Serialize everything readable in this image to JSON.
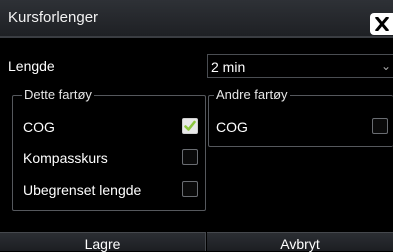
{
  "dialog": {
    "title": "Kursforlenger",
    "close_icon": "close-icon"
  },
  "length": {
    "label": "Lengde",
    "value": "2 min",
    "arrow_icon": "chevron-down-icon"
  },
  "own_vessel": {
    "legend": "Dette fartøy",
    "items": [
      {
        "label": "COG",
        "checked": true
      },
      {
        "label": "Kompasskurs",
        "checked": false
      },
      {
        "label": "Ubegrenset lengde",
        "checked": false
      }
    ]
  },
  "other_vessels": {
    "legend": "Andre fartøy",
    "items": [
      {
        "label": "COG",
        "checked": false
      }
    ]
  },
  "buttons": {
    "save": "Lagre",
    "cancel": "Avbryt"
  },
  "colors": {
    "check_mark": "#8cc63f",
    "background": "#000000"
  }
}
